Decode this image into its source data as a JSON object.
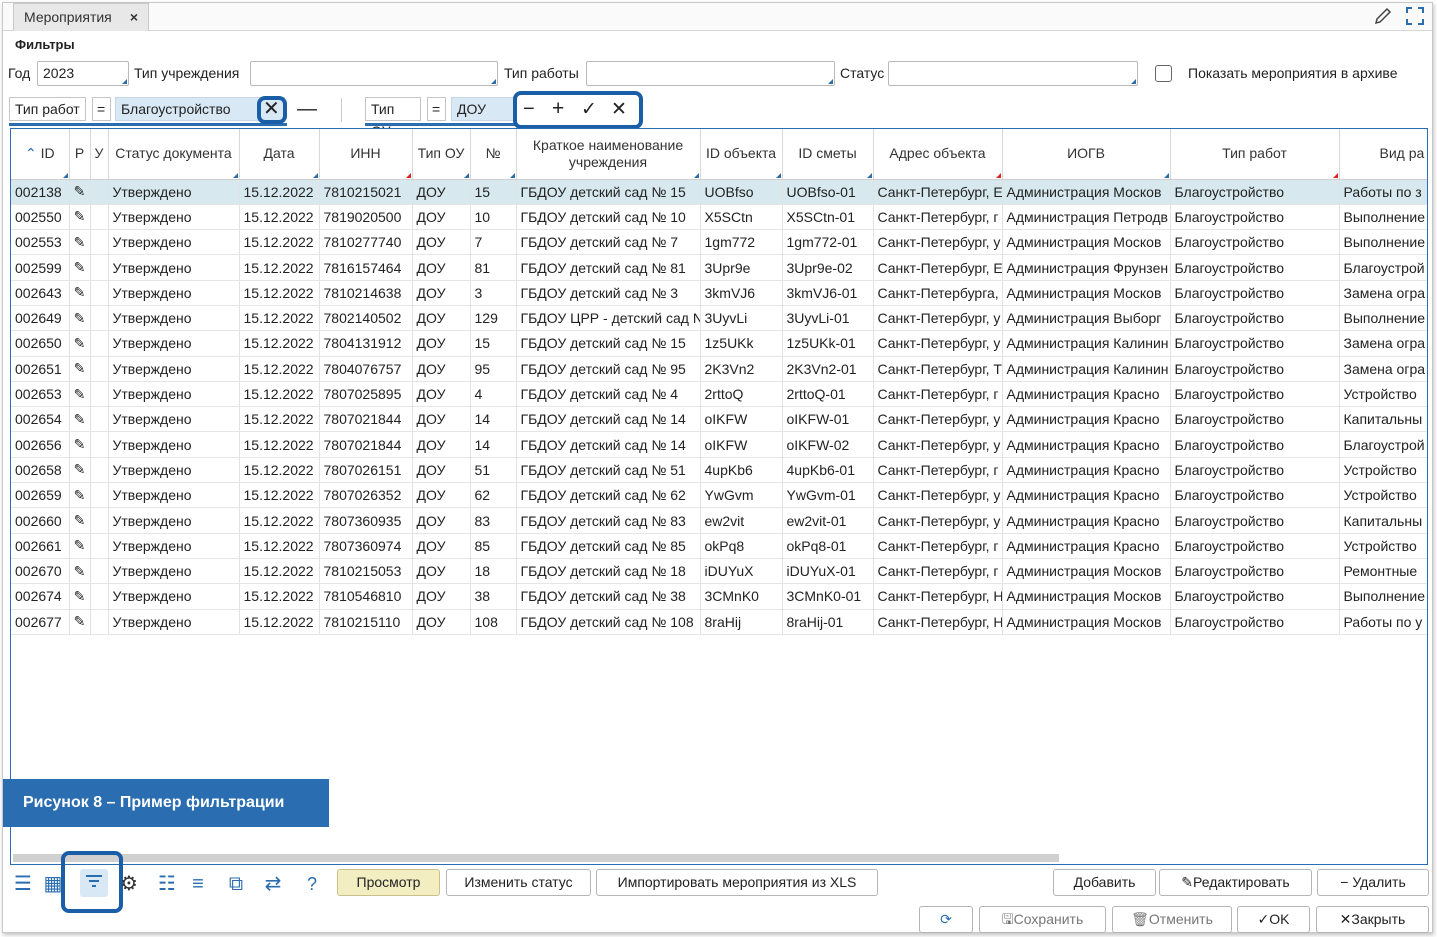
{
  "window": {
    "tab_title": "Мероприятия"
  },
  "filters": {
    "title": "Фильтры",
    "year_label": "Год",
    "year_value": "2023",
    "institution_type_label": "Тип учреждения",
    "institution_type_value": "",
    "work_type_label": "Тип работы",
    "work_type_value": "",
    "status_label": "Статус",
    "status_value": "",
    "archive_label": "Показать мероприятия в архиве"
  },
  "quick_filter": {
    "f1_field": "Тип работ",
    "f1_op": "=",
    "f1_value": "Благоустройство",
    "f2_field": "Тип ОУ",
    "f2_op": "=",
    "f2_value": "ДОУ"
  },
  "grid": {
    "headers": [
      "ID",
      "Р",
      "У",
      "Статус документа",
      "Дата",
      "ИНН",
      "Тип ОУ",
      "№",
      "Краткое наименование учреждения",
      "ID объекта",
      "ID сметы",
      "Адрес объекта",
      "ИОГВ",
      "Тип работ",
      "Вид ра"
    ],
    "rows": [
      [
        "002138",
        "Утверждено",
        "15.12.2022",
        "7810215021",
        "ДОУ",
        "15",
        "ГБДОУ детский сад № 15",
        "UOBfso",
        "UOBfso-01",
        "Санкт-Петербург, Е",
        "Администрация Москов",
        "Благоустройство",
        "Работы по з"
      ],
      [
        "002550",
        "Утверждено",
        "15.12.2022",
        "7819020500",
        "ДОУ",
        "10",
        "ГБДОУ детский сад № 10",
        "X5SCtn",
        "X5SCtn-01",
        "Санкт-Петербург, г",
        "Администрация Петродв",
        "Благоустройство",
        "Выполнение"
      ],
      [
        "002553",
        "Утверждено",
        "15.12.2022",
        "7810277740",
        "ДОУ",
        "7",
        "ГБДОУ детский сад № 7",
        "1gm772",
        "1gm772-01",
        "Санкт-Петербург, у",
        "Администрация Москов",
        "Благоустройство",
        "Выполнение"
      ],
      [
        "002599",
        "Утверждено",
        "15.12.2022",
        "7816157464",
        "ДОУ",
        "81",
        "ГБДОУ детский сад № 81",
        "3Upr9e",
        "3Upr9e-02",
        "Санкт-Петербург, Е",
        "Администрация Фрунзен",
        "Благоустройство",
        "Благоустрой"
      ],
      [
        "002643",
        "Утверждено",
        "15.12.2022",
        "7810214638",
        "ДОУ",
        "3",
        "ГБДОУ детский сад № 3",
        "3kmVJ6",
        "3kmVJ6-01",
        "Санкт-Петербурга,",
        "Администрация Москов",
        "Благоустройство",
        "Замена огра"
      ],
      [
        "002649",
        "Утверждено",
        "15.12.2022",
        "7802140502",
        "ДОУ",
        "129",
        "ГБДОУ ЦРР - детский сад N",
        "3UyvLi",
        "3UyvLi-01",
        "Санкт-Петербург, у",
        "Администрация Выборг",
        "Благоустройство",
        "Выполнение"
      ],
      [
        "002650",
        "Утверждено",
        "15.12.2022",
        "7804131912",
        "ДОУ",
        "15",
        "ГБДОУ детский сад № 15",
        "1z5UKk",
        "1z5UKk-01",
        "Санкт-Петербург, у",
        "Администрация Калинин",
        "Благоустройство",
        "Замена огра"
      ],
      [
        "002651",
        "Утверждено",
        "15.12.2022",
        "7804076757",
        "ДОУ",
        "95",
        "ГБДОУ детский сад № 95",
        "2K3Vn2",
        "2K3Vn2-01",
        "Санкт-Петербург, Т",
        "Администрация Калинин",
        "Благоустройство",
        "Замена огра"
      ],
      [
        "002653",
        "Утверждено",
        "15.12.2022",
        "7807025895",
        "ДОУ",
        "4",
        "ГБДОУ детский сад № 4",
        "2rttoQ",
        "2rttoQ-01",
        "Санкт-Петербург, г",
        "Администрация Красно",
        "Благоустройство",
        "Устройство"
      ],
      [
        "002654",
        "Утверждено",
        "15.12.2022",
        "7807021844",
        "ДОУ",
        "14",
        "ГБДОУ детский сад № 14",
        "oIKFW",
        "oIKFW-01",
        "Санкт-Петербург, у",
        "Администрация Красно",
        "Благоустройство",
        "Капитальны"
      ],
      [
        "002656",
        "Утверждено",
        "15.12.2022",
        "7807021844",
        "ДОУ",
        "14",
        "ГБДОУ детский сад № 14",
        "oIKFW",
        "oIKFW-02",
        "Санкт-Петербург, у",
        "Администрация Красно",
        "Благоустройство",
        "Благоустрой"
      ],
      [
        "002658",
        "Утверждено",
        "15.12.2022",
        "7807026151",
        "ДОУ",
        "51",
        "ГБДОУ детский сад № 51",
        "4upKb6",
        "4upKb6-01",
        "Санкт-Петербург, г",
        "Администрация Красно",
        "Благоустройство",
        "Устройство"
      ],
      [
        "002659",
        "Утверждено",
        "15.12.2022",
        "7807026352",
        "ДОУ",
        "62",
        "ГБДОУ детский сад № 62",
        "YwGvm",
        "YwGvm-01",
        "Санкт-Петербург, у",
        "Администрация Красно",
        "Благоустройство",
        "Устройство"
      ],
      [
        "002660",
        "Утверждено",
        "15.12.2022",
        "7807360935",
        "ДОУ",
        "83",
        "ГБДОУ детский сад № 83",
        "ew2vit",
        "ew2vit-01",
        "Санкт-Петербург, у",
        "Администрация Красно",
        "Благоустройство",
        "Капитальны"
      ],
      [
        "002661",
        "Утверждено",
        "15.12.2022",
        "7807360974",
        "ДОУ",
        "85",
        "ГБДОУ детский сад № 85",
        "okPq8",
        "okPq8-01",
        "Санкт-Петербург, г",
        "Администрация Красно",
        "Благоустройство",
        "Устройство"
      ],
      [
        "002670",
        "Утверждено",
        "15.12.2022",
        "7810215053",
        "ДОУ",
        "18",
        "ГБДОУ детский сад № 18",
        "iDUYuX",
        "iDUYuX-01",
        "Санкт-Петербург, г",
        "Администрация Москов",
        "Благоустройство",
        "Ремонтные"
      ],
      [
        "002674",
        "Утверждено",
        "15.12.2022",
        "7810546810",
        "ДОУ",
        "38",
        "ГБДОУ детский сад № 38",
        "3CMnK0",
        "3CMnK0-01",
        "Санкт-Петербург, Н",
        "Администрация Москов",
        "Благоустройство",
        "Выполнение"
      ],
      [
        "002677",
        "Утверждено",
        "15.12.2022",
        "7810215110",
        "ДОУ",
        "108",
        "ГБДОУ детский сад № 108",
        "8raHij",
        "8raHij-01",
        "Санкт-Петербург, Н",
        "Администрация Москов",
        "Благоустройство",
        "Работы по у"
      ]
    ]
  },
  "caption": "Рисунок 8 – Пример фильтрации",
  "toolbar": {
    "view": "Просмотр",
    "change_status": "Изменить статус",
    "import_xls": "Импортировать мероприятия из XLS",
    "add": "Добавить",
    "edit": "Редактировать",
    "delete": "Удалить",
    "save": "Сохранить",
    "cancel": "Отменить",
    "ok": "OK",
    "close": "Закрыть",
    "help": "?"
  }
}
